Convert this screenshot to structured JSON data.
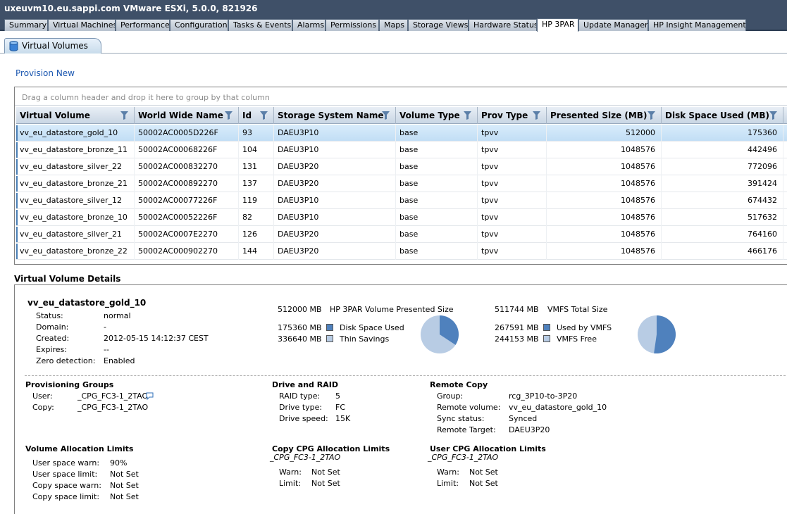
{
  "window": {
    "title": "uxeuvm10.eu.sappi.com VMware ESXi, 5.0.0, 821926"
  },
  "tabs": [
    {
      "label": "Summary"
    },
    {
      "label": "Virtual Machines"
    },
    {
      "label": "Performance"
    },
    {
      "label": "Configuration"
    },
    {
      "label": "Tasks & Events"
    },
    {
      "label": "Alarms"
    },
    {
      "label": "Permissions"
    },
    {
      "label": "Maps"
    },
    {
      "label": "Storage Views"
    },
    {
      "label": "Hardware Status"
    },
    {
      "label": "HP 3PAR",
      "active": true
    },
    {
      "label": "Update Manager"
    },
    {
      "label": "HP Insight Management"
    }
  ],
  "subtab": {
    "label": "Virtual Volumes",
    "icon": "database-icon"
  },
  "provision_link": "Provision New",
  "grid": {
    "group_hint": "Drag a column header and drop it here to group by that column",
    "columns": [
      "Virtual Volume",
      "World Wide Name",
      "Id",
      "Storage System Name",
      "Volume Type",
      "Prov Type",
      "Presented Size (MB)",
      "Disk Space Used (MB)"
    ],
    "rows": [
      [
        "vv_eu_datastore_gold_10",
        "50002AC0005D226F",
        "93",
        "DAEU3P10",
        "base",
        "tpvv",
        "512000",
        "175360"
      ],
      [
        "vv_eu_datastore_bronze_11",
        "50002AC00068226F",
        "104",
        "DAEU3P10",
        "base",
        "tpvv",
        "1048576",
        "442496"
      ],
      [
        "vv_eu_datastore_silver_22",
        "50002AC000832270",
        "131",
        "DAEU3P20",
        "base",
        "tpvv",
        "1048576",
        "772096"
      ],
      [
        "vv_eu_datastore_bronze_21",
        "50002AC000892270",
        "137",
        "DAEU3P20",
        "base",
        "tpvv",
        "1048576",
        "391424"
      ],
      [
        "vv_eu_datastore_silver_12",
        "50002AC00077226F",
        "119",
        "DAEU3P10",
        "base",
        "tpvv",
        "1048576",
        "674432"
      ],
      [
        "vv_eu_datastore_bronze_10",
        "50002AC00052226F",
        "82",
        "DAEU3P10",
        "base",
        "tpvv",
        "1048576",
        "517632"
      ],
      [
        "vv_eu_datastore_silver_21",
        "50002AC0007E2270",
        "126",
        "DAEU3P20",
        "base",
        "tpvv",
        "1048576",
        "764160"
      ],
      [
        "vv_eu_datastore_bronze_22",
        "50002AC000902270",
        "144",
        "DAEU3P20",
        "base",
        "tpvv",
        "1048576",
        "466176"
      ]
    ],
    "selected_row": 0
  },
  "details": {
    "title": "Virtual Volume Details",
    "volume_name": "vv_eu_datastore_gold_10",
    "info": {
      "status_label": "Status:",
      "status": "normal",
      "domain_label": "Domain:",
      "domain": "-",
      "created_label": "Created:",
      "created": "2012-05-15 14:12:37 CEST",
      "expires_label": "Expires:",
      "expires": "--",
      "zero_label": "Zero detection:",
      "zero": "Enabled"
    },
    "hp3par": {
      "presented_value": "512000 MB",
      "presented_label": "HP 3PAR Volume Presented Size",
      "used_value": "175360 MB",
      "used_label": "Disk Space Used",
      "thin_value": "336640 MB",
      "thin_label": "Thin Savings",
      "used_color": "#4f81bd",
      "thin_color": "#b8cce4"
    },
    "vmfs": {
      "total_value": "511744 MB",
      "total_label": "VMFS Total Size",
      "used_value": "267591 MB",
      "used_label": "Used by VMFS",
      "free_value": "244153 MB",
      "free_label": "VMFS Free",
      "used_color": "#4f81bd",
      "free_color": "#b8cce4"
    },
    "provisioning_groups": {
      "heading": "Provisioning Groups",
      "user_label": "User:",
      "user": "_CPG_FC3-1_2TAO",
      "copy_label": "Copy:",
      "copy": "_CPG_FC3-1_2TAO"
    },
    "drive_raid": {
      "heading": "Drive and RAID",
      "raid_label": "RAID type:",
      "raid": "5",
      "type_label": "Drive type:",
      "type": "FC",
      "speed_label": "Drive speed:",
      "speed": "15K"
    },
    "remote_copy": {
      "heading": "Remote Copy",
      "group_label": "Group:",
      "group": "rcg_3P10-to-3P20",
      "volume_label": "Remote volume:",
      "volume": "vv_eu_datastore_gold_10",
      "sync_label": "Sync status:",
      "sync": "Synced",
      "target_label": "Remote Target:",
      "target": "DAEU3P20"
    },
    "volume_alloc": {
      "heading": "Volume Allocation Limits",
      "usw_label": "User space warn:",
      "usw": "90%",
      "usl_label": "User space limit:",
      "usl": "Not Set",
      "csw_label": "Copy space warn:",
      "csw": "Not Set",
      "csl_label": "Copy space limit:",
      "csl": "Not Set"
    },
    "copy_cpg": {
      "heading": "Copy CPG Allocation Limits",
      "cpg": "_CPG_FC3-1_2TAO",
      "warn_label": "Warn:",
      "warn": "Not Set",
      "limit_label": "Limit:",
      "limit": "Not Set"
    },
    "user_cpg": {
      "heading": "User CPG Allocation Limits",
      "cpg": "_CPG_FC3-1_2TAO",
      "warn_label": "Warn:",
      "warn": "Not Set",
      "limit_label": "Limit:",
      "limit": "Not Set"
    }
  },
  "pies": {
    "hp3par": {
      "used_fraction": 0.3425
    },
    "vmfs": {
      "used_fraction": 0.5229
    }
  }
}
